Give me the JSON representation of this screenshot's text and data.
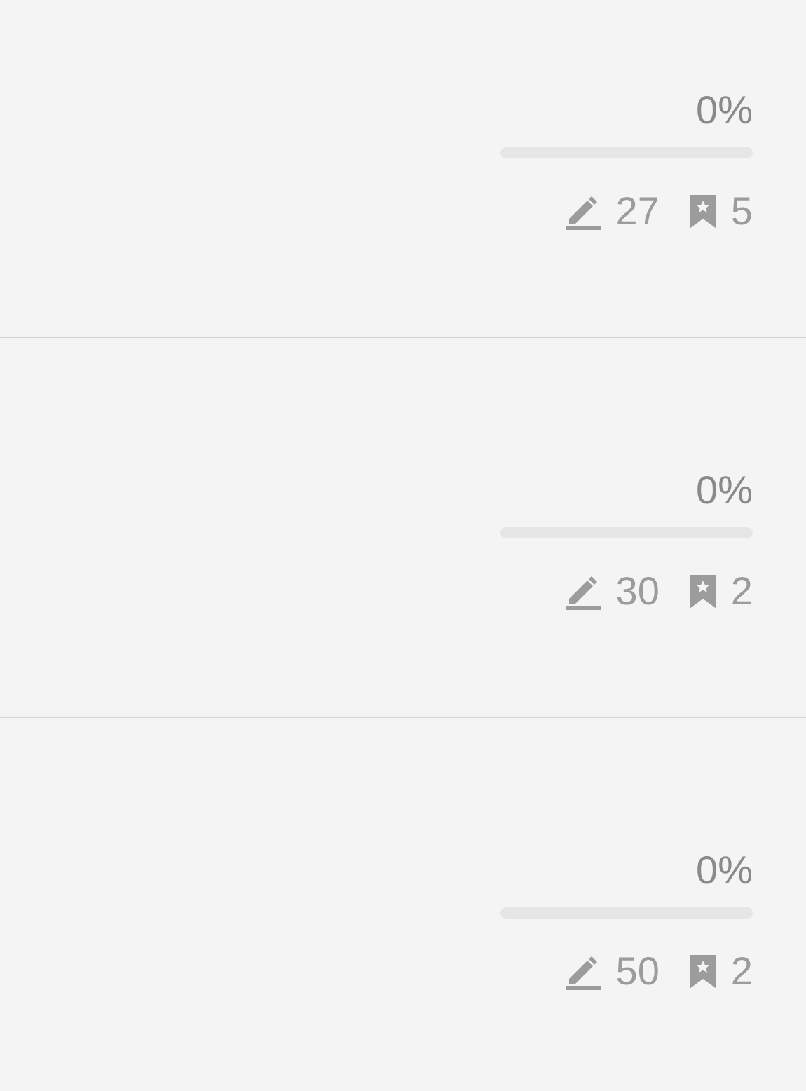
{
  "items": [
    {
      "percent": "0%",
      "level": 0,
      "edits": "27",
      "bookmarks": "5"
    },
    {
      "percent": "0%",
      "level": 0,
      "edits": "30",
      "bookmarks": "2"
    },
    {
      "percent": "0%",
      "level": 0,
      "edits": "50",
      "bookmarks": "2"
    }
  ]
}
